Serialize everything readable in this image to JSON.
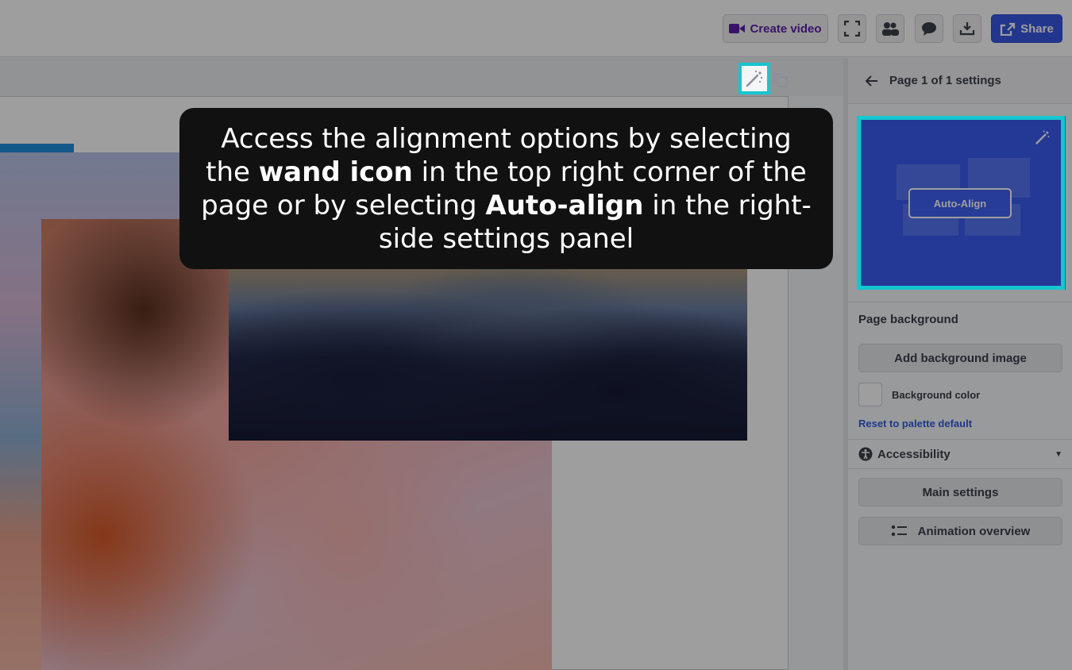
{
  "toolbar": {
    "create_video_label": "Create video",
    "share_label": "Share",
    "icons": [
      "video-icon",
      "fullscreen-icon",
      "collaborators-icon",
      "comment-icon",
      "download-icon",
      "share-icon"
    ]
  },
  "canvas": {
    "wand_icon": "magic-wand-icon",
    "duplicate_icon": "duplicate-icon"
  },
  "panel": {
    "header_title": "Page 1 of 1 settings",
    "preview_button_label": "Auto-Align",
    "page_background_title": "Page background",
    "add_background_image_label": "Add background image",
    "background_color_label": "Background color",
    "reset_link_label": "Reset to palette default",
    "accessibility_label": "Accessibility",
    "main_settings_label": "Main settings",
    "animation_overview_label": "Animation overview"
  },
  "tooltip": {
    "part1": "Access the alignment options by selecting the ",
    "bold1": "wand icon",
    "part2": " in the top right corner of the page or by selecting ",
    "bold2": "Auto-align",
    "part3": " in the right-side settings panel"
  },
  "colors": {
    "highlight": "#15c5cf",
    "share_button": "#3757e6",
    "create_video_text": "#5b1fa8",
    "preview_background": "#3a5cf0"
  }
}
